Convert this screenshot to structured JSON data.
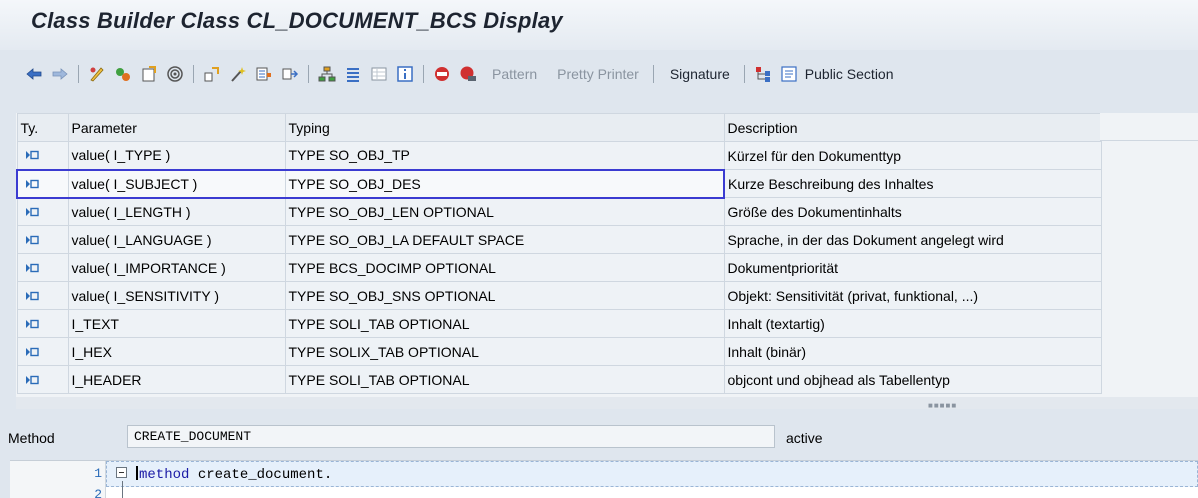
{
  "window": {
    "title": "Class Builder Class CL_DOCUMENT_BCS Display"
  },
  "toolbar": {
    "pattern_label": "Pattern",
    "pretty_printer_label": "Pretty Printer",
    "signature_label": "Signature",
    "public_section_label": "Public Section"
  },
  "params_table": {
    "columns": [
      "Ty.",
      "Parameter",
      "Typing",
      "Description"
    ],
    "rows": [
      {
        "parameter": "value( I_TYPE )",
        "typing": "TYPE SO_OBJ_TP",
        "description": "Kürzel für den Dokumenttyp"
      },
      {
        "parameter": "value( I_SUBJECT )",
        "typing": "TYPE SO_OBJ_DES",
        "description": "Kurze Beschreibung des Inhaltes"
      },
      {
        "parameter": "value( I_LENGTH )",
        "typing": "TYPE SO_OBJ_LEN OPTIONAL",
        "description": "Größe des Dokumentinhalts"
      },
      {
        "parameter": "value( I_LANGUAGE )",
        "typing": "TYPE SO_OBJ_LA  DEFAULT SPACE",
        "description": "Sprache, in der das Dokument angelegt wird"
      },
      {
        "parameter": "value( I_IMPORTANCE )",
        "typing": "TYPE BCS_DOCIMP OPTIONAL",
        "description": "Dokumentpriorität"
      },
      {
        "parameter": "value( I_SENSITIVITY )",
        "typing": "TYPE SO_OBJ_SNS OPTIONAL",
        "description": "Objekt: Sensitivität (privat, funktional, ...)"
      },
      {
        "parameter": "I_TEXT",
        "typing": "TYPE SOLI_TAB OPTIONAL",
        "description": "Inhalt (textartig)"
      },
      {
        "parameter": "I_HEX",
        "typing": "TYPE SOLIX_TAB OPTIONAL",
        "description": "Inhalt (binär)"
      },
      {
        "parameter": "I_HEADER",
        "typing": "TYPE SOLI_TAB OPTIONAL",
        "description": "objcont und objhead als Tabellentyp"
      }
    ]
  },
  "method": {
    "label": "Method",
    "name": "CREATE_DOCUMENT",
    "status": "active"
  },
  "editor": {
    "lines": [
      {
        "number": "1",
        "keyword": "method",
        "rest": " create_document."
      },
      {
        "number": "2"
      }
    ]
  }
}
